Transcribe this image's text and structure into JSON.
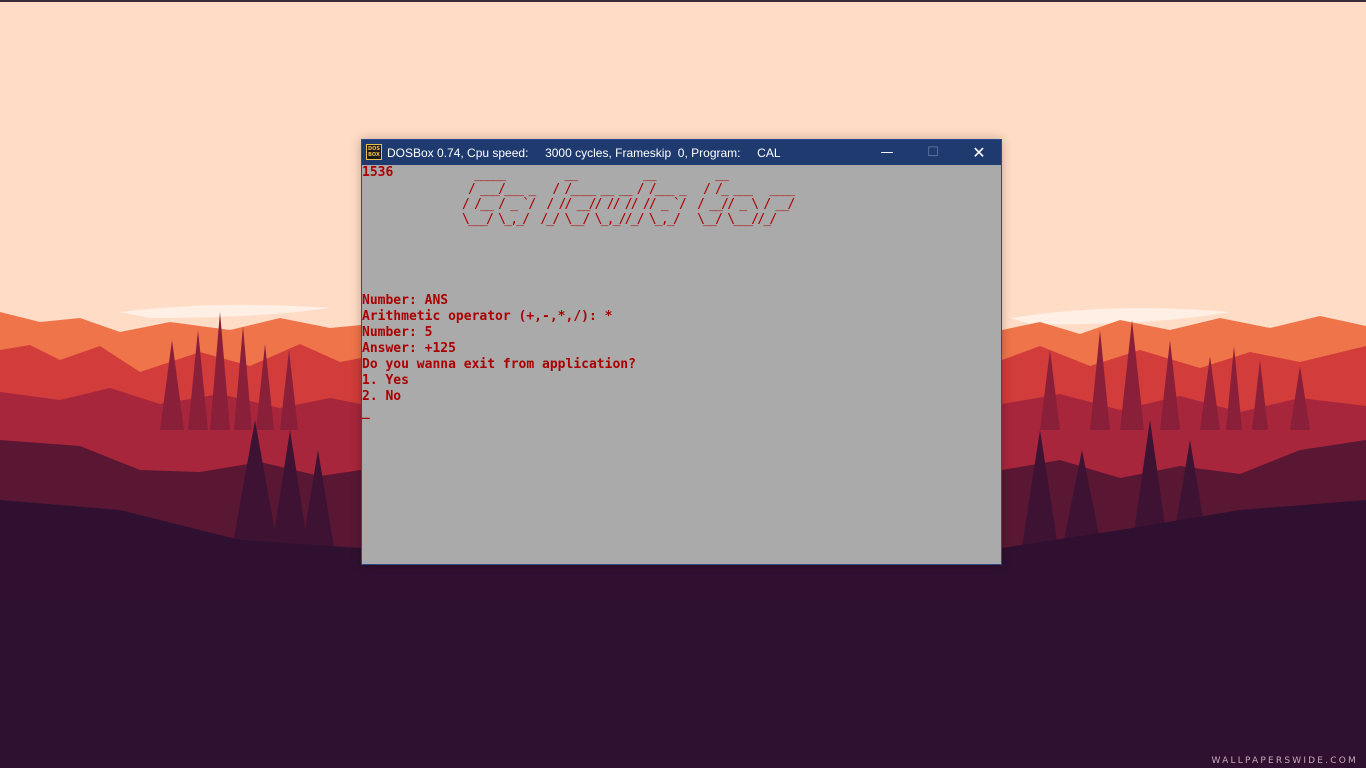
{
  "desktop": {
    "watermark": "WALLPAPERSWIDE.COM",
    "colors": {
      "sky": "#ffdcc6",
      "mountain_far": "#f0744a",
      "mountain_mid": "#c2303e",
      "hill": "#7e1e3a",
      "forest": "#2f1030"
    }
  },
  "window": {
    "title": "DOSBox 0.74, Cpu speed:     3000 cycles, Frameskip  0, Program:     CAL",
    "icon_line1": "DOS",
    "icon_line2": "BOX",
    "minimize_symbol": "—",
    "maximize_symbol": "☐",
    "close_symbol": "✕",
    "colors": {
      "titlebar": "#1e3a6e",
      "screen_bg": "#aaaaaa",
      "text": "#aa0000"
    }
  },
  "terminal": {
    "counter": "1536",
    "ascii_banner": "   _____          __           __          __               \n  / ___/___ _   / /____ __ __ / /___ _   / /_ ___   ____  \n / /__ / _ `/  / // __// // // // _ `/  / __// _ \\ / __/  \n \\___/ \\_,_/  /_/ \\__/ \\_,_//_/ \\_,_/   \\__/ \\___//_/     ",
    "lines": [
      "Number: ANS",
      "Arithmetic operator (+,-,*,/): *",
      "Number: 5",
      "Answer: +125",
      "Do you wanna exit from application?",
      "1. Yes",
      "2. No"
    ],
    "cursor": "_"
  }
}
